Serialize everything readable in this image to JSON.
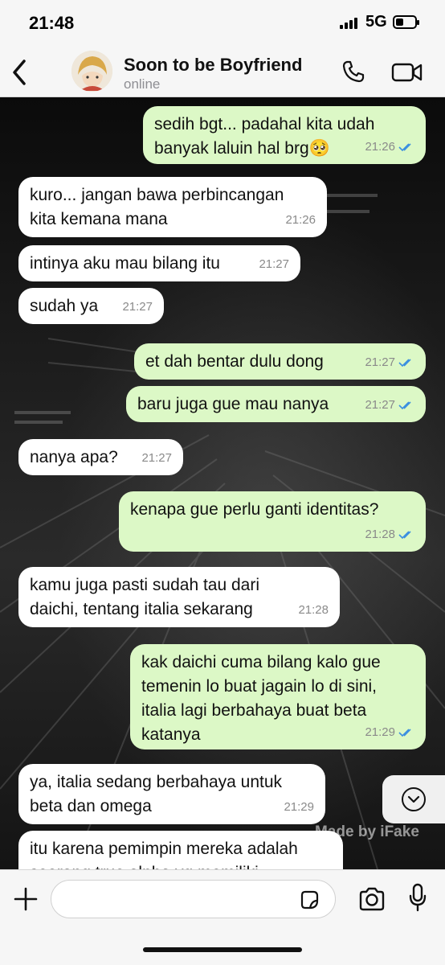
{
  "status_bar": {
    "time": "21:48",
    "network": "5G"
  },
  "header": {
    "contact_name": "Soon to be Boyfriend",
    "contact_status": "online",
    "icons": [
      "back-chevron-icon",
      "phone-icon",
      "video-camera-icon"
    ]
  },
  "messages": [
    {
      "dir": "out",
      "text": "sedih bgt... padahal kita udah\nbanyak laluin hal brg🥺",
      "time": "21:26",
      "read": true
    },
    {
      "dir": "in",
      "text": "kuro... jangan bawa perbincangan\nkita kemana mana",
      "time": "21:26"
    },
    {
      "dir": "in",
      "text": "intinya aku mau bilang itu",
      "time": "21:27"
    },
    {
      "dir": "in",
      "text": "sudah ya",
      "time": "21:27"
    },
    {
      "dir": "out",
      "text": "et dah bentar dulu dong",
      "time": "21:27",
      "read": true
    },
    {
      "dir": "out",
      "text": "baru juga gue mau nanya",
      "time": "21:27",
      "read": true
    },
    {
      "dir": "in",
      "text": "nanya apa?",
      "time": "21:27"
    },
    {
      "dir": "out",
      "text": "kenapa gue perlu ganti identitas?",
      "time": "21:28",
      "read": true
    },
    {
      "dir": "in",
      "text": "kamu juga pasti sudah tau dari\ndaichi, tentang italia sekarang",
      "time": "21:28"
    },
    {
      "dir": "out",
      "text": "kak daichi cuma bilang kalo gue\ntemenin lo buat jagain lo di sini,\nitalia lagi berbahaya buat beta\nkatanya",
      "time": "21:29",
      "read": true
    },
    {
      "dir": "in",
      "text": "ya, italia sedang berbahaya untuk\nbeta dan omega",
      "time": "21:29"
    },
    {
      "dir": "in",
      "text": "itu karena pemimpin mereka adalah\nseorang true alpha yg memiliki",
      "time": ""
    }
  ],
  "watermark": "Made by iFake",
  "input": {
    "placeholder": ""
  },
  "colors": {
    "outgoing_bubble": "#dcf8c6",
    "incoming_bubble": "#ffffff",
    "read_ticks": "#3b8fe0"
  }
}
